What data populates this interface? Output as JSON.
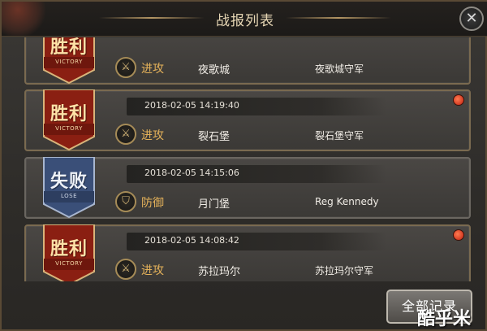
{
  "window": {
    "title": "战报列表",
    "close_glyph": "✕"
  },
  "reports": [
    {
      "result": "胜利",
      "result_en": "VICTORY",
      "time": "",
      "action": "进攻",
      "city": "夜歌城",
      "enemy": "夜歌城守军",
      "unread": false
    },
    {
      "result": "胜利",
      "result_en": "VICTORY",
      "time": "2018-02-05 14:19:40",
      "action": "进攻",
      "city": "裂石堡",
      "enemy": "裂石堡守军",
      "unread": true
    },
    {
      "result": "失败",
      "result_en": "LOSE",
      "time": "2018-02-05 14:15:06",
      "action": "防御",
      "city": "月门堡",
      "enemy": "Reg Kennedy",
      "unread": false
    },
    {
      "result": "胜利",
      "result_en": "VICTORY",
      "time": "2018-02-05 14:08:42",
      "action": "进攻",
      "city": "苏拉玛尔",
      "enemy": "苏拉玛尔守军",
      "unread": true
    }
  ],
  "footer": {
    "all_records_label": "全部记录"
  },
  "watermark": "酷乎米",
  "icons": {
    "attack": "sword-icon",
    "defense": "shield-icon",
    "unread": "unread-dot-icon",
    "close": "close-icon"
  },
  "colors": {
    "victory_banner": "#8a1f12",
    "lose_banner": "#3a4f78",
    "action_text": "#e5b25a",
    "card_border": "#7a6a50"
  }
}
